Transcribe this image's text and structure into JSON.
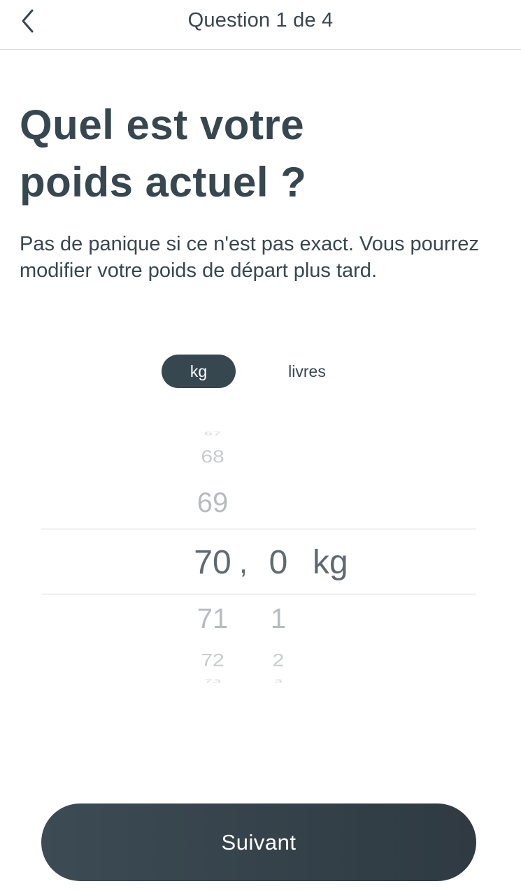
{
  "header": {
    "title": "Question 1 de 4",
    "back_icon": "chevron-left-icon"
  },
  "question": {
    "title_line1": "Quel est votre",
    "title_line2": "poids actuel ?",
    "description": "Pas de panique si ce n'est pas exact. Vous pourrez modifier votre poids de départ plus tard."
  },
  "unit_toggle": {
    "options": [
      "kg",
      "livres"
    ],
    "selected": "kg"
  },
  "weight_picker": {
    "integer_visible": [
      "68",
      "69",
      "70",
      "71",
      "72"
    ],
    "decimal_visible": [
      "0",
      "1",
      "2"
    ],
    "selected_integer": "70",
    "selected_decimal": "0",
    "separator": ",",
    "unit": "kg"
  },
  "footer": {
    "next_label": "Suivant"
  },
  "colors": {
    "primary": "#37474f",
    "button_gradient_start": "#3c4b54",
    "button_gradient_end": "#2f3a42",
    "divider": "#d4d7d9",
    "picker_selected": "#5f6a70",
    "picker_dim": "#b8bcbf"
  }
}
